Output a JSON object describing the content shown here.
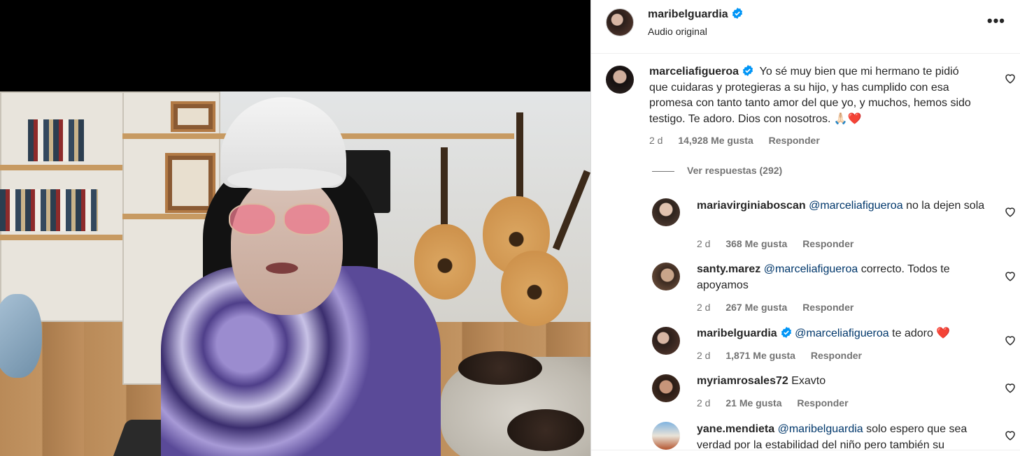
{
  "header": {
    "username": "maribelguardia",
    "subtitle": "Audio original",
    "more_icon": "more-options-icon"
  },
  "main_comment": {
    "username": "marceliafigueroa",
    "text": "Yo sé muy bien que mi hermano te pidió que cuidaras y protegieras a su hijo, y has cumplido con esa promesa con tanto tanto amor del que yo, y muchos, hemos sido testigo. Te adoro. Dios con nosotros. 🙏🏻❤️",
    "time": "2 d",
    "likes": "14,928 Me gusta",
    "reply": "Responder",
    "view_replies": "Ver respuestas (292)"
  },
  "replies": [
    {
      "username": "mariavirginiaboscan",
      "verified": false,
      "mention": "@marceliafigueroa",
      "text": "no la dejen sola",
      "time": "2 d",
      "likes": "368 Me gusta",
      "reply": "Responder"
    },
    {
      "username": "santy.marez",
      "verified": false,
      "mention": "@marceliafigueroa",
      "text": "correcto. Todos te apoyamos",
      "time": "2 d",
      "likes": "267 Me gusta",
      "reply": "Responder"
    },
    {
      "username": "maribelguardia",
      "verified": true,
      "mention": "@marceliafigueroa",
      "text": "te adoro ❤️",
      "time": "2 d",
      "likes": "1,871 Me gusta",
      "reply": "Responder"
    },
    {
      "username": "myriamrosales72",
      "verified": false,
      "mention": "",
      "text": "Exavto",
      "time": "2 d",
      "likes": "21 Me gusta",
      "reply": "Responder"
    },
    {
      "username": "yane.mendieta",
      "verified": false,
      "mention": "@maribelguardia",
      "text": "solo espero que sea verdad por la estabilidad del niño pero también su",
      "time": "",
      "likes": "",
      "reply": ""
    }
  ],
  "colors": {
    "verified": "#0095f6",
    "mention": "#00376b",
    "meta": "#737373",
    "text": "#262626"
  }
}
